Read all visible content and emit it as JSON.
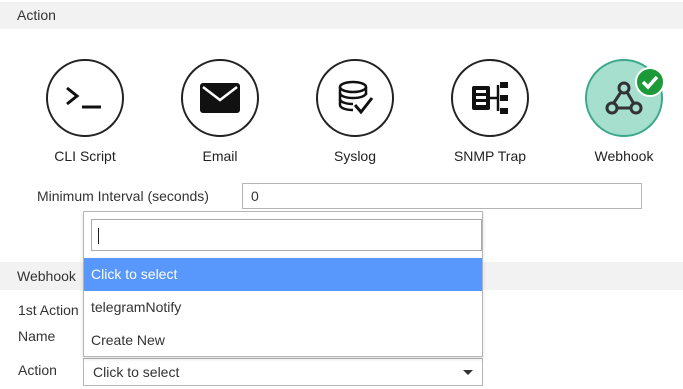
{
  "sections": {
    "action_header": "Action",
    "webhook_header": "Webhook"
  },
  "action_options": [
    {
      "label": "CLI Script",
      "icon": "terminal-icon",
      "selected": false
    },
    {
      "label": "Email",
      "icon": "email-icon",
      "selected": false
    },
    {
      "label": "Syslog",
      "icon": "syslog-icon",
      "selected": false
    },
    {
      "label": "SNMP Trap",
      "icon": "snmp-trap-icon",
      "selected": false
    },
    {
      "label": "Webhook",
      "icon": "webhook-icon",
      "selected": true
    }
  ],
  "min_interval": {
    "label": "Minimum Interval (seconds)",
    "value": "0"
  },
  "webhook_fields": {
    "first_action_label": "1st Action",
    "name_label": "Name",
    "action_label": "Action"
  },
  "dropdown": {
    "search_value": "",
    "items": [
      {
        "label": "Click to select",
        "highlighted": true
      },
      {
        "label": "telegramNotify",
        "highlighted": false
      },
      {
        "label": "Create New",
        "highlighted": false
      }
    ]
  },
  "action_select": {
    "value": "Click to select"
  },
  "colors": {
    "highlight": "#5897fb",
    "selected_fill": "#a7dfcf",
    "check_badge": "#1c9a39",
    "header_bg": "#f2f2f2"
  }
}
